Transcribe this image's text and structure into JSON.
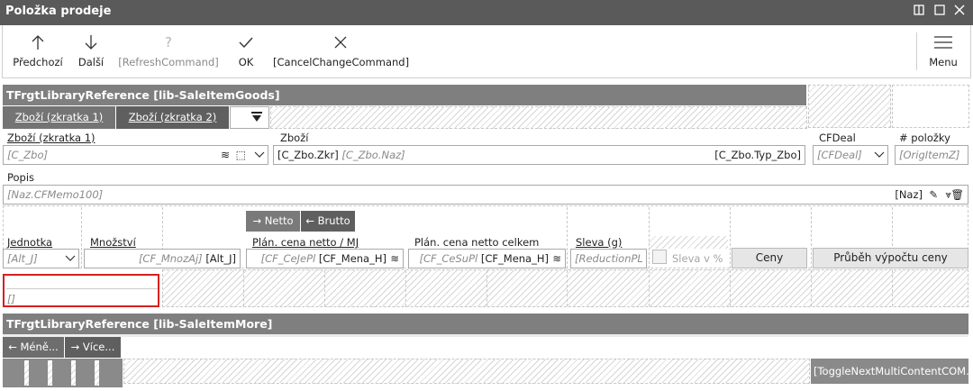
{
  "window": {
    "title": "Položka prodeje",
    "icons": [
      "restore-icon",
      "maximize-icon",
      "close-icon"
    ]
  },
  "toolbar": {
    "prev": "Předchozí",
    "next": "Další",
    "refresh": "[RefreshCommand]",
    "ok": "OK",
    "cancel": "[CancelChangeCommand]",
    "menu": "Menu"
  },
  "section1": {
    "header": "TFrgtLibraryReference [lib-SaleItemGoods]",
    "tab1": "Zboží (zkratka 1)",
    "tab2": "Zboží (zkratka 2)",
    "zbozi_zkr_label": "Zboží (zkratka 1)",
    "zbozi_zkr_ph": "[C_Zbo]",
    "zbozi_label": "Zboží",
    "zbozi_val1": "[C_Zbo.Zkr]",
    "zbozi_val2": "[C_Zbo.Naz]",
    "zbozi_val3": "[C_Zbo.Typ_Zbo]",
    "cfdeal_label": "CFDeal",
    "cfdeal_ph": "[CFDeal]",
    "polozky_label": "# položky",
    "polozky_ph": "[OrigItemZ]",
    "popis_label": "Popis",
    "popis_ph": "[Naz.CFMemo100]",
    "popis_right": "[Naz]",
    "netto": "Netto",
    "brutto": "Brutto",
    "jednotka_label": "Jednotka",
    "jednotka_ph": "[Alt_J]",
    "mnozstvi_label": "Množství",
    "mnozstvi_ph": "[CF_MnozAj]",
    "mnozstvi_unit": "[Alt_J]",
    "cena_mj_label": "Plán. cena netto / MJ",
    "cena_mj_ph": "[CF_CeJePl",
    "cena_mj_cur": "[CF_Mena_H]",
    "cena_celk_label": "Plán. cena netto celkem",
    "cena_celk_ph": "[CF_CeSuPl",
    "cena_celk_cur": "[CF_Mena_H]",
    "sleva_label": "Sleva (g)",
    "sleva_ph": "[ReductionPL",
    "sleva_pct": "Sleva v %",
    "ceny_btn": "Ceny",
    "prubeh_btn": "Průběh výpočtu ceny",
    "empty_field": "[]"
  },
  "section2": {
    "header": "TFrgtLibraryReference [lib-SaleItemMore]",
    "mene": "Méně...",
    "vice": "Více...",
    "toggle": "[ToggleNextMultiContentCOM..."
  }
}
